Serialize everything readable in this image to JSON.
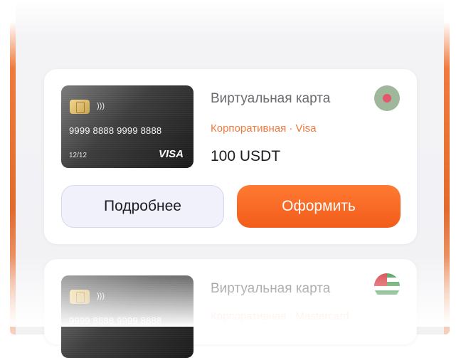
{
  "offers": [
    {
      "title": "Виртуальная карта",
      "subtitle": "Корпоративная · Visa",
      "price": "100 USDT",
      "card": {
        "number": "9999 8888 9999 8888",
        "expiry": "12/12",
        "brand": "VISA"
      },
      "flag_icon": "region-flag-icon",
      "details_label": "Подробнее",
      "order_label": "Оформить"
    },
    {
      "title": "Виртуальная карта",
      "subtitle": "Корпоративная · Mastercard",
      "card": {
        "number": "9999 8888 9999 8888"
      },
      "flag_icon": "abkhazia-flag-icon"
    }
  ],
  "colors": {
    "accent": "#f25c1a",
    "subtitle": "#f07a3d",
    "secondary_button": "#f0f1fa"
  }
}
